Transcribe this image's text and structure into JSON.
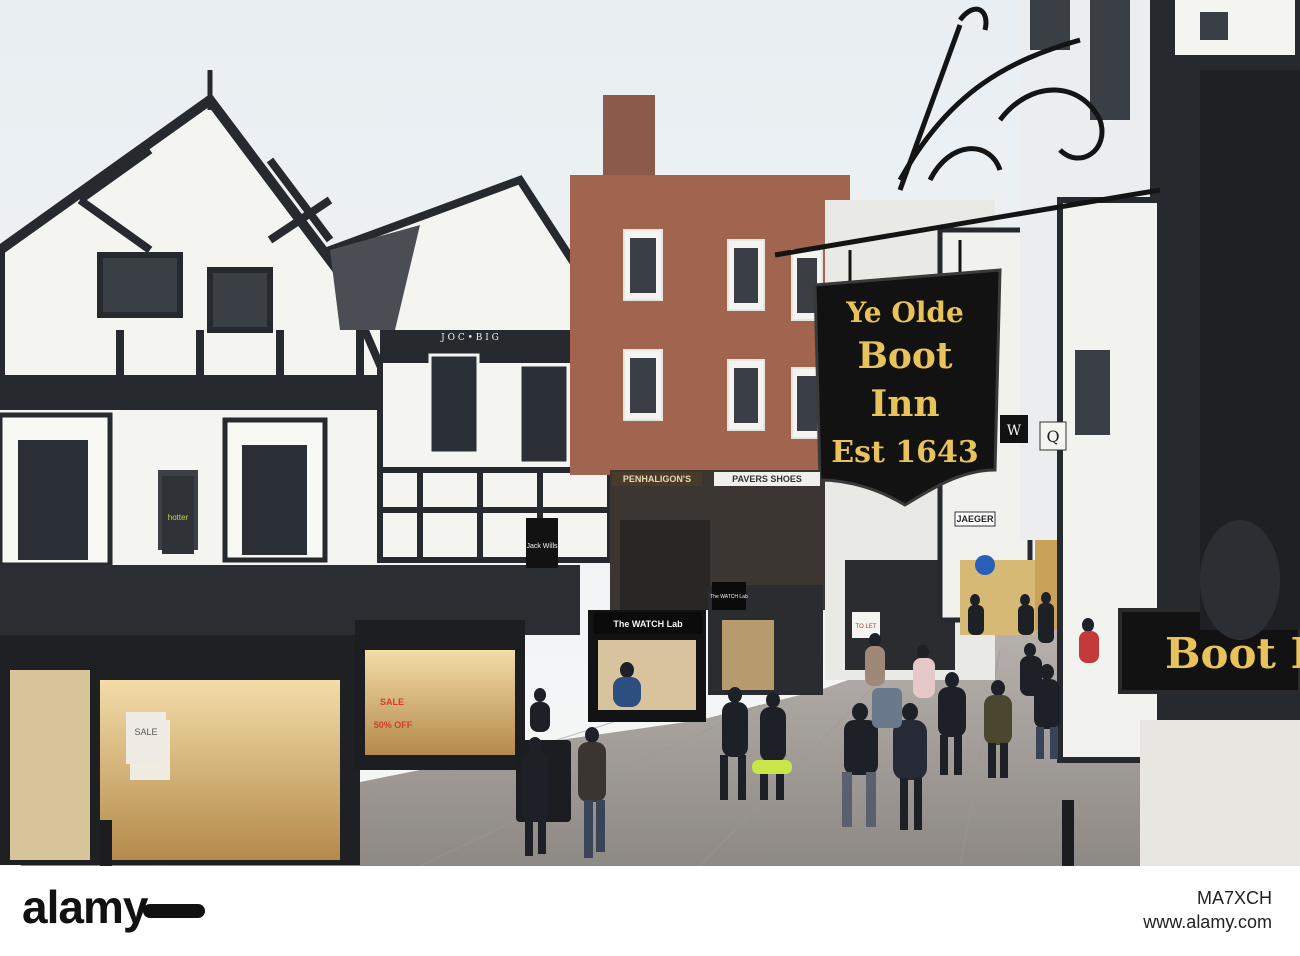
{
  "pub_sign": {
    "line1": "Ye Olde",
    "line2": "Boot",
    "line3": "Inn",
    "line4": "Est 1643"
  },
  "fascia_sign": {
    "text": "Boot I"
  },
  "shop_signs": {
    "watch_lab": "The WATCH Lab",
    "watch_lab_small": "The WATCH Lab",
    "penhaligons": "PENHALIGON'S",
    "pavers": "PAVERS SHOES",
    "jack_wills": "Jack Wills",
    "sale_window": "SALE",
    "sale_offer": "50% OFF",
    "sale_board": "SALE",
    "jaeger": "JAEGER",
    "letting": "TO LET",
    "w_sign": "W",
    "q_sign": "Q",
    "hotter": "hotter",
    "timber_inscription": "J O C • B I G"
  },
  "watermark": {
    "logo": "alamy",
    "image_id": "MA7XCH",
    "url": "www.alamy.com"
  },
  "colors": {
    "sky": "#eef2f4",
    "timber": "#26292d",
    "plaster": "#f4f4f1",
    "brick": "#a0644f",
    "sign_gold": "#e8c25a",
    "sign_black": "#121212"
  }
}
